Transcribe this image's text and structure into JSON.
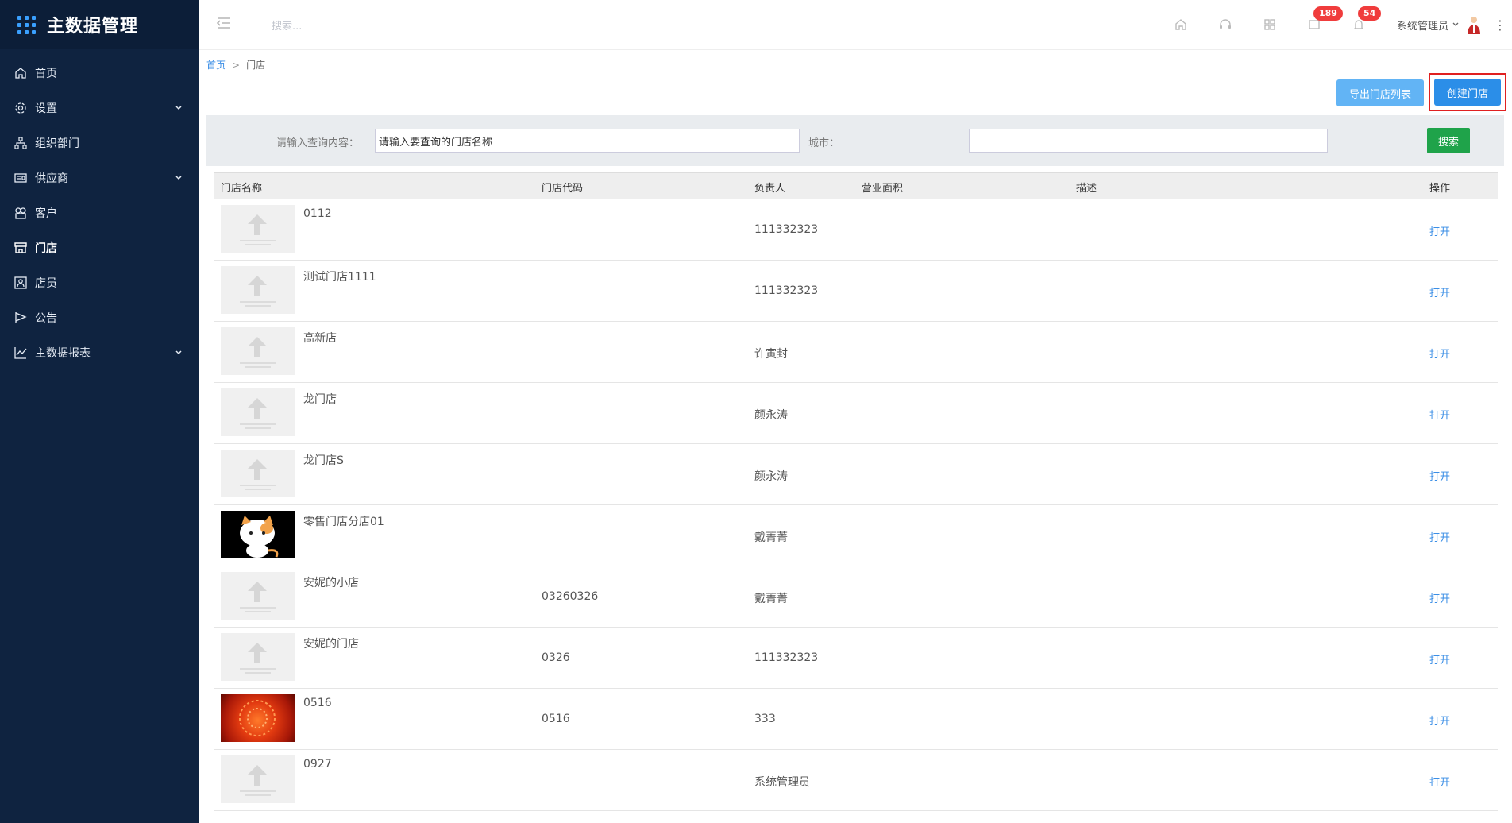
{
  "app": {
    "title": "主数据管理"
  },
  "sidebar": {
    "items": [
      {
        "label": "首页",
        "icon": "home-icon",
        "has_chevron": false,
        "active": false
      },
      {
        "label": "设置",
        "icon": "gear-icon",
        "has_chevron": true,
        "active": false
      },
      {
        "label": "组织部门",
        "icon": "org-chart-icon",
        "has_chevron": false,
        "active": false
      },
      {
        "label": "供应商",
        "icon": "supplier-card-icon",
        "has_chevron": true,
        "active": false
      },
      {
        "label": "客户",
        "icon": "customer-icon",
        "has_chevron": false,
        "active": false
      },
      {
        "label": "门店",
        "icon": "store-icon",
        "has_chevron": false,
        "active": true
      },
      {
        "label": "店员",
        "icon": "staff-icon",
        "has_chevron": false,
        "active": false
      },
      {
        "label": "公告",
        "icon": "announcement-flag-icon",
        "has_chevron": false,
        "active": false
      },
      {
        "label": "主数据报表",
        "icon": "line-chart-icon",
        "has_chevron": true,
        "active": false
      }
    ]
  },
  "topbar": {
    "search_placeholder": "搜索...",
    "messages_count": "189",
    "notifications_count": "54",
    "user_name": "系统管理员"
  },
  "breadcrumb": {
    "home": "首页",
    "sep": ">",
    "current": "门店"
  },
  "actions": {
    "export_label": "导出门店列表",
    "create_label": "创建门店"
  },
  "filter": {
    "query_label": "请输入查询内容：",
    "query_value": "请输入要查询的门店名称",
    "city_label": "城市：",
    "city_value": "",
    "search_label": "搜索"
  },
  "table": {
    "headers": {
      "name": "门店名称",
      "code": "门店代码",
      "owner": "负责人",
      "area": "营业面积",
      "desc": "描述",
      "op": "操作"
    },
    "rows": [
      {
        "name": "0112",
        "code": "",
        "owner": "111332323",
        "op": "打开",
        "thumb": "placeholder"
      },
      {
        "name": "测试门店1111",
        "code": "",
        "owner": "111332323",
        "op": "打开",
        "thumb": "placeholder"
      },
      {
        "name": "高新店",
        "code": "",
        "owner": "许寅封",
        "op": "打开",
        "thumb": "placeholder"
      },
      {
        "name": "龙门店",
        "code": "",
        "owner": "颜永涛",
        "op": "打开",
        "thumb": "placeholder"
      },
      {
        "name": "龙门店S",
        "code": "",
        "owner": "颜永涛",
        "op": "打开",
        "thumb": "placeholder"
      },
      {
        "name": "零售门店分店01",
        "code": "",
        "owner": "戴菁菁",
        "op": "打开",
        "thumb": "cat"
      },
      {
        "name": "安妮的小店",
        "code": "03260326",
        "owner": "戴菁菁",
        "op": "打开",
        "thumb": "placeholder"
      },
      {
        "name": "安妮的门店",
        "code": "0326",
        "owner": "111332323",
        "op": "打开",
        "thumb": "placeholder"
      },
      {
        "name": "0516",
        "code": "0516",
        "owner": "333",
        "op": "打开",
        "thumb": "flower"
      },
      {
        "name": "0927",
        "code": "",
        "owner": "系统管理员",
        "op": "打开",
        "thumb": "placeholder"
      }
    ]
  },
  "colors": {
    "sidebar_bg": "#0f2340",
    "primary": "#2b8ee8",
    "export": "#62b4f5",
    "search": "#1fa34a",
    "badge": "#f03c3c",
    "highlight": "#e02020"
  }
}
